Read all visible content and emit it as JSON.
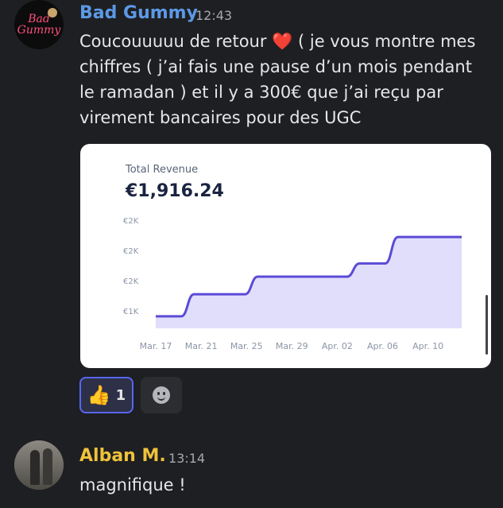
{
  "messages": [
    {
      "username": "Bad Gummy",
      "time": "12:43",
      "avatar_text": [
        "Bad",
        "Gummy"
      ],
      "text_before_emoji": "Coucouuuuu de retour ",
      "emoji": "❤️",
      "text_after_emoji": " ( je vous montre mes chiffres ( j’ai fais une pause d’un mois pendant le ramadan ) et il y a 300€ que j’ai reçu par virement bancaires pour des UGC",
      "attachment": {
        "title": "Total Revenue",
        "value": "€1,916.24"
      },
      "reaction": {
        "emoji": "👍",
        "count": "1"
      }
    },
    {
      "username": "Alban M.",
      "time": "13:14",
      "text": "magnifique !"
    }
  ],
  "chart_data": {
    "type": "area",
    "x_ticks": [
      "Mar. 17",
      "Mar. 21",
      "Mar. 25",
      "Mar. 29",
      "Apr. 02",
      "Apr. 06",
      "Apr. 10"
    ],
    "y_ticks": [
      "€1K",
      "€2K",
      "€2K",
      "€2K"
    ],
    "x": [
      "Mar. 17",
      "Mar. 19",
      "Mar. 20",
      "Mar. 22",
      "Mar. 24",
      "Mar. 25",
      "Mar. 27",
      "Mar. 29",
      "Apr. 01",
      "Apr. 02",
      "Apr. 04",
      "Apr. 05",
      "Apr. 07",
      "Apr. 10"
    ],
    "values": [
      1000,
      1000,
      1250,
      1250,
      1250,
      1450,
      1450,
      1450,
      1450,
      1600,
      1600,
      1900,
      1900,
      1900
    ],
    "color": "#5b4bd6",
    "fill": "#dcd8fb"
  }
}
